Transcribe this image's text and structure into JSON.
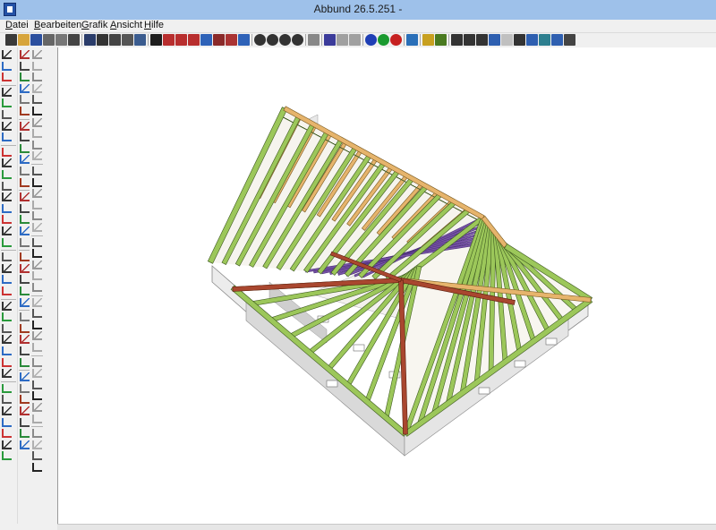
{
  "window": {
    "title": "Abbund 26.5.251 -"
  },
  "menu": {
    "items": [
      "Datei",
      "Bearbeiten",
      "Grafik",
      "Ansicht",
      "Hilfe"
    ]
  },
  "toolbar": {
    "icons": [
      "new-file-icon",
      "open-folder-icon",
      "save-icon",
      "print-icon",
      "print-preview-icon",
      "page-setup-icon",
      "view-1-icon",
      "view-2-icon",
      "view-3-icon",
      "view-4-icon",
      "view-5-icon",
      "view-3d-icon",
      "view-plan-icon",
      "view-front-icon",
      "view-side-icon",
      "view-detail-icon",
      "element-1-icon",
      "element-2-icon",
      "element-3-icon",
      "zoom-in-icon",
      "zoom-out-icon",
      "zoom-window-icon",
      "zoom-all-icon",
      "undo-icon",
      "edit-icon",
      "check-icon",
      "cancel-icon",
      "info-blue-icon",
      "info-green-icon",
      "info-red-icon",
      "layer-icon",
      "help-icon",
      "help-context-icon",
      "window-1-icon",
      "window-2-icon",
      "window-3-icon",
      "window-4-icon",
      "window-5-icon",
      "window-6-icon",
      "window-7-icon",
      "window-8-icon",
      "window-9-icon",
      "window-10-icon"
    ]
  },
  "colors": {
    "title_bar": "#9ec1ea",
    "rafter_green": "#9cc75a",
    "purlin_orange": "#e6b46c",
    "hip_red": "#a9472f",
    "brace_purple": "#7a55a8",
    "wall_gray": "#d9d9d9"
  }
}
